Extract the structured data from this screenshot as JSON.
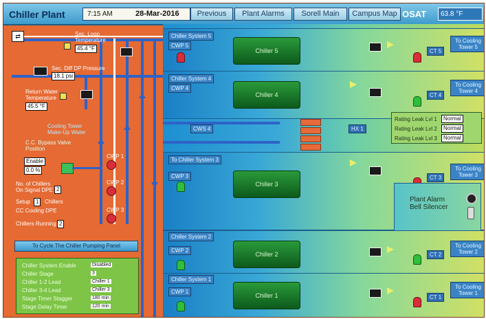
{
  "header": {
    "title": "Chiller Plant",
    "time": "7:15 AM",
    "date": "28-Mar-2016",
    "nav": [
      "Previous",
      "Plant Alarms",
      "Sorell Main",
      "Campus Map"
    ],
    "osat_label": "OSAT",
    "osat_value": "63.8 °F"
  },
  "left_panel": {
    "sec_loop_temp_label": "Sec. Loop Temperature",
    "sec_loop_temp": "45.4 °F",
    "sec_flow_label": "Sec. Diff DP Pressure",
    "sec_flow": "18.1 psi",
    "return_temp_label": "Return Water Temperature",
    "return_temp": "45.5 °F",
    "bypass_label": "Cooling Tower Make-Up Water",
    "bypass_note": "C.C. Bypass Valve Position",
    "bypass_state": "Enable",
    "bypass_value": "0.0 %",
    "no_of_chillers_label": "No. of Chillers On Signal DPE",
    "no_of_chillers_val": "2",
    "setup_label": "Setup",
    "setup_val": "1",
    "setup_suffix": "Chillers",
    "cc_cooling_label": "CC Cooling DPE",
    "chiller_running_label": "Chillers Running",
    "chiller_running_val": "2",
    "pump_labels": [
      "CWP 1",
      "CWP 2",
      "CWP 3"
    ],
    "cycle_button": "To Cycle The Chiller Pumping Panel"
  },
  "status_box": {
    "rows": [
      {
        "label": "Chiller System Enable",
        "value": "Disabled"
      },
      {
        "label": "Chiller Stage",
        "value": "3"
      },
      {
        "label": "Chiller 1-2 Lead",
        "value": "Chiller 1"
      },
      {
        "label": "Chiller 3-4 Lead",
        "value": "Chiller 3"
      },
      {
        "label": "Stage Timer Stagger",
        "value": "180 min"
      },
      {
        "label": "Stage Delay Timer",
        "value": "120 min"
      }
    ]
  },
  "systems": [
    {
      "tag": "Chiller System 5",
      "pump": "CWP 5",
      "chiller": "Chiller 5",
      "tower": "To Cooling Tower 5",
      "tower_pos": "CT 5"
    },
    {
      "tag": "Chiller System 4",
      "pump": "CWP 4",
      "chiller": "Chiller 4",
      "tower": "To Cooling Tower 4",
      "tower_pos": "CT 4"
    },
    {
      "tag": "To Chiller System 3",
      "pump": "CWP 3",
      "chiller": "Chiller 3",
      "tower": "To Cooling Tower 3",
      "tower_pos": "CT 3"
    },
    {
      "tag": "Chiller System 2",
      "pump": "CWP 2",
      "chiller": "Chiller 2",
      "tower": "To Cooling Tower 2",
      "tower_pos": "CT 2"
    },
    {
      "tag": "Chiller System 1",
      "pump": "CWP 1",
      "chiller": "Chiller 1",
      "tower": "To Cooling Tower 1",
      "tower_pos": "CT 1"
    }
  ],
  "he_label": "CWS 4",
  "hx_tag": "HX 1",
  "rating": {
    "rows": [
      {
        "label": "Rating Leak Lvl 1",
        "value": "Normal"
      },
      {
        "label": "Rating Leak Lvl 2",
        "value": "Normal"
      },
      {
        "label": "Rating Leak Lvl 3",
        "value": "Normal"
      }
    ]
  },
  "plant_alarm": {
    "label": "Plant Alarm Bell Silencer"
  },
  "colors": {
    "orange": "#e56a33",
    "blue_pipe": "#2d63c8",
    "chiller_green": "#1e7a2c",
    "header_blue": "#3d9ccd"
  }
}
